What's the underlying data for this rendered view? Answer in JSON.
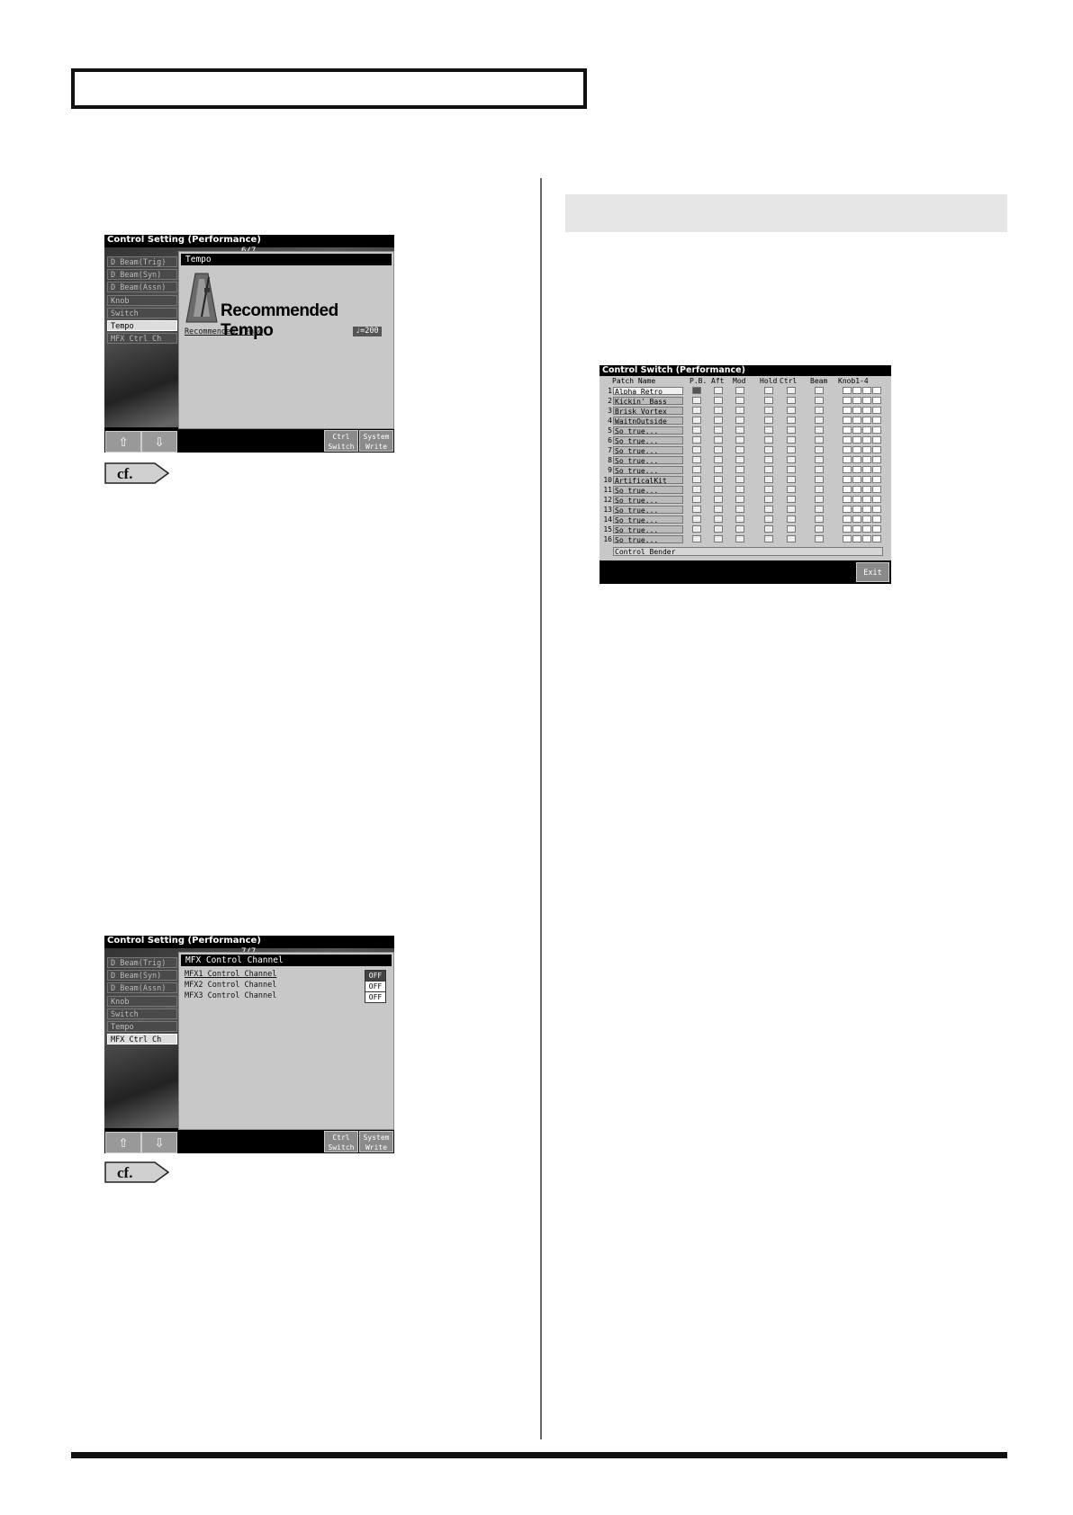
{
  "screen1": {
    "title": "Control Setting (Performance)",
    "page": "6/7",
    "side_items": [
      "D Beam(Trig)",
      "D Beam(Syn)",
      "D Beam(Assn)",
      "Knob",
      "Switch",
      "Tempo",
      "MFX Ctrl Ch"
    ],
    "active_index": 5,
    "panel_title": "Tempo",
    "big_text": "Recommended Tempo",
    "rec_label": "Recommended Tempo",
    "rec_value": "♩=200",
    "soft1_a": "Ctrl",
    "soft1_b": "Switch",
    "soft2_a": "System",
    "soft2_b": "Write"
  },
  "screen2": {
    "title": "Control Setting (Performance)",
    "page": "7/7",
    "side_items": [
      "D Beam(Trig)",
      "D Beam(Syn)",
      "D Beam(Assn)",
      "Knob",
      "Switch",
      "Tempo",
      "MFX Ctrl Ch"
    ],
    "active_index": 6,
    "panel_title": "MFX Control Channel",
    "rows": [
      {
        "label": "MFX1 Control Channel",
        "value": "OFF"
      },
      {
        "label": "MFX2 Control Channel",
        "value": "OFF"
      },
      {
        "label": "MFX3 Control Channel",
        "value": "OFF"
      }
    ],
    "soft1_a": "Ctrl",
    "soft1_b": "Switch",
    "soft2_a": "System",
    "soft2_b": "Write"
  },
  "cf_label": "cf.",
  "control_switch": {
    "title": "Control Switch (Performance)",
    "headers": {
      "patch_name": "Patch Name",
      "pb": "P.B.",
      "aft": "Aft",
      "mod": "Mod",
      "hold": "Hold",
      "ctrl": "Ctrl",
      "beam": "Beam",
      "knob": "Knob1-4"
    },
    "rows": [
      {
        "num": "1",
        "name": "Alpha Retro"
      },
      {
        "num": "2",
        "name": "Kickin' Bass"
      },
      {
        "num": "3",
        "name": "Brisk Vortex"
      },
      {
        "num": "4",
        "name": "WaitnOutside"
      },
      {
        "num": "5",
        "name": "So true..."
      },
      {
        "num": "6",
        "name": "So true..."
      },
      {
        "num": "7",
        "name": "So true..."
      },
      {
        "num": "8",
        "name": "So true..."
      },
      {
        "num": "9",
        "name": "So true..."
      },
      {
        "num": "10",
        "name": "ArtificalKit"
      },
      {
        "num": "11",
        "name": "So true..."
      },
      {
        "num": "12",
        "name": "So true..."
      },
      {
        "num": "13",
        "name": "So true..."
      },
      {
        "num": "14",
        "name": "So true..."
      },
      {
        "num": "15",
        "name": "So true..."
      },
      {
        "num": "16",
        "name": "So true..."
      }
    ],
    "footer_label": "Control Bender",
    "exit_label": "Exit"
  }
}
